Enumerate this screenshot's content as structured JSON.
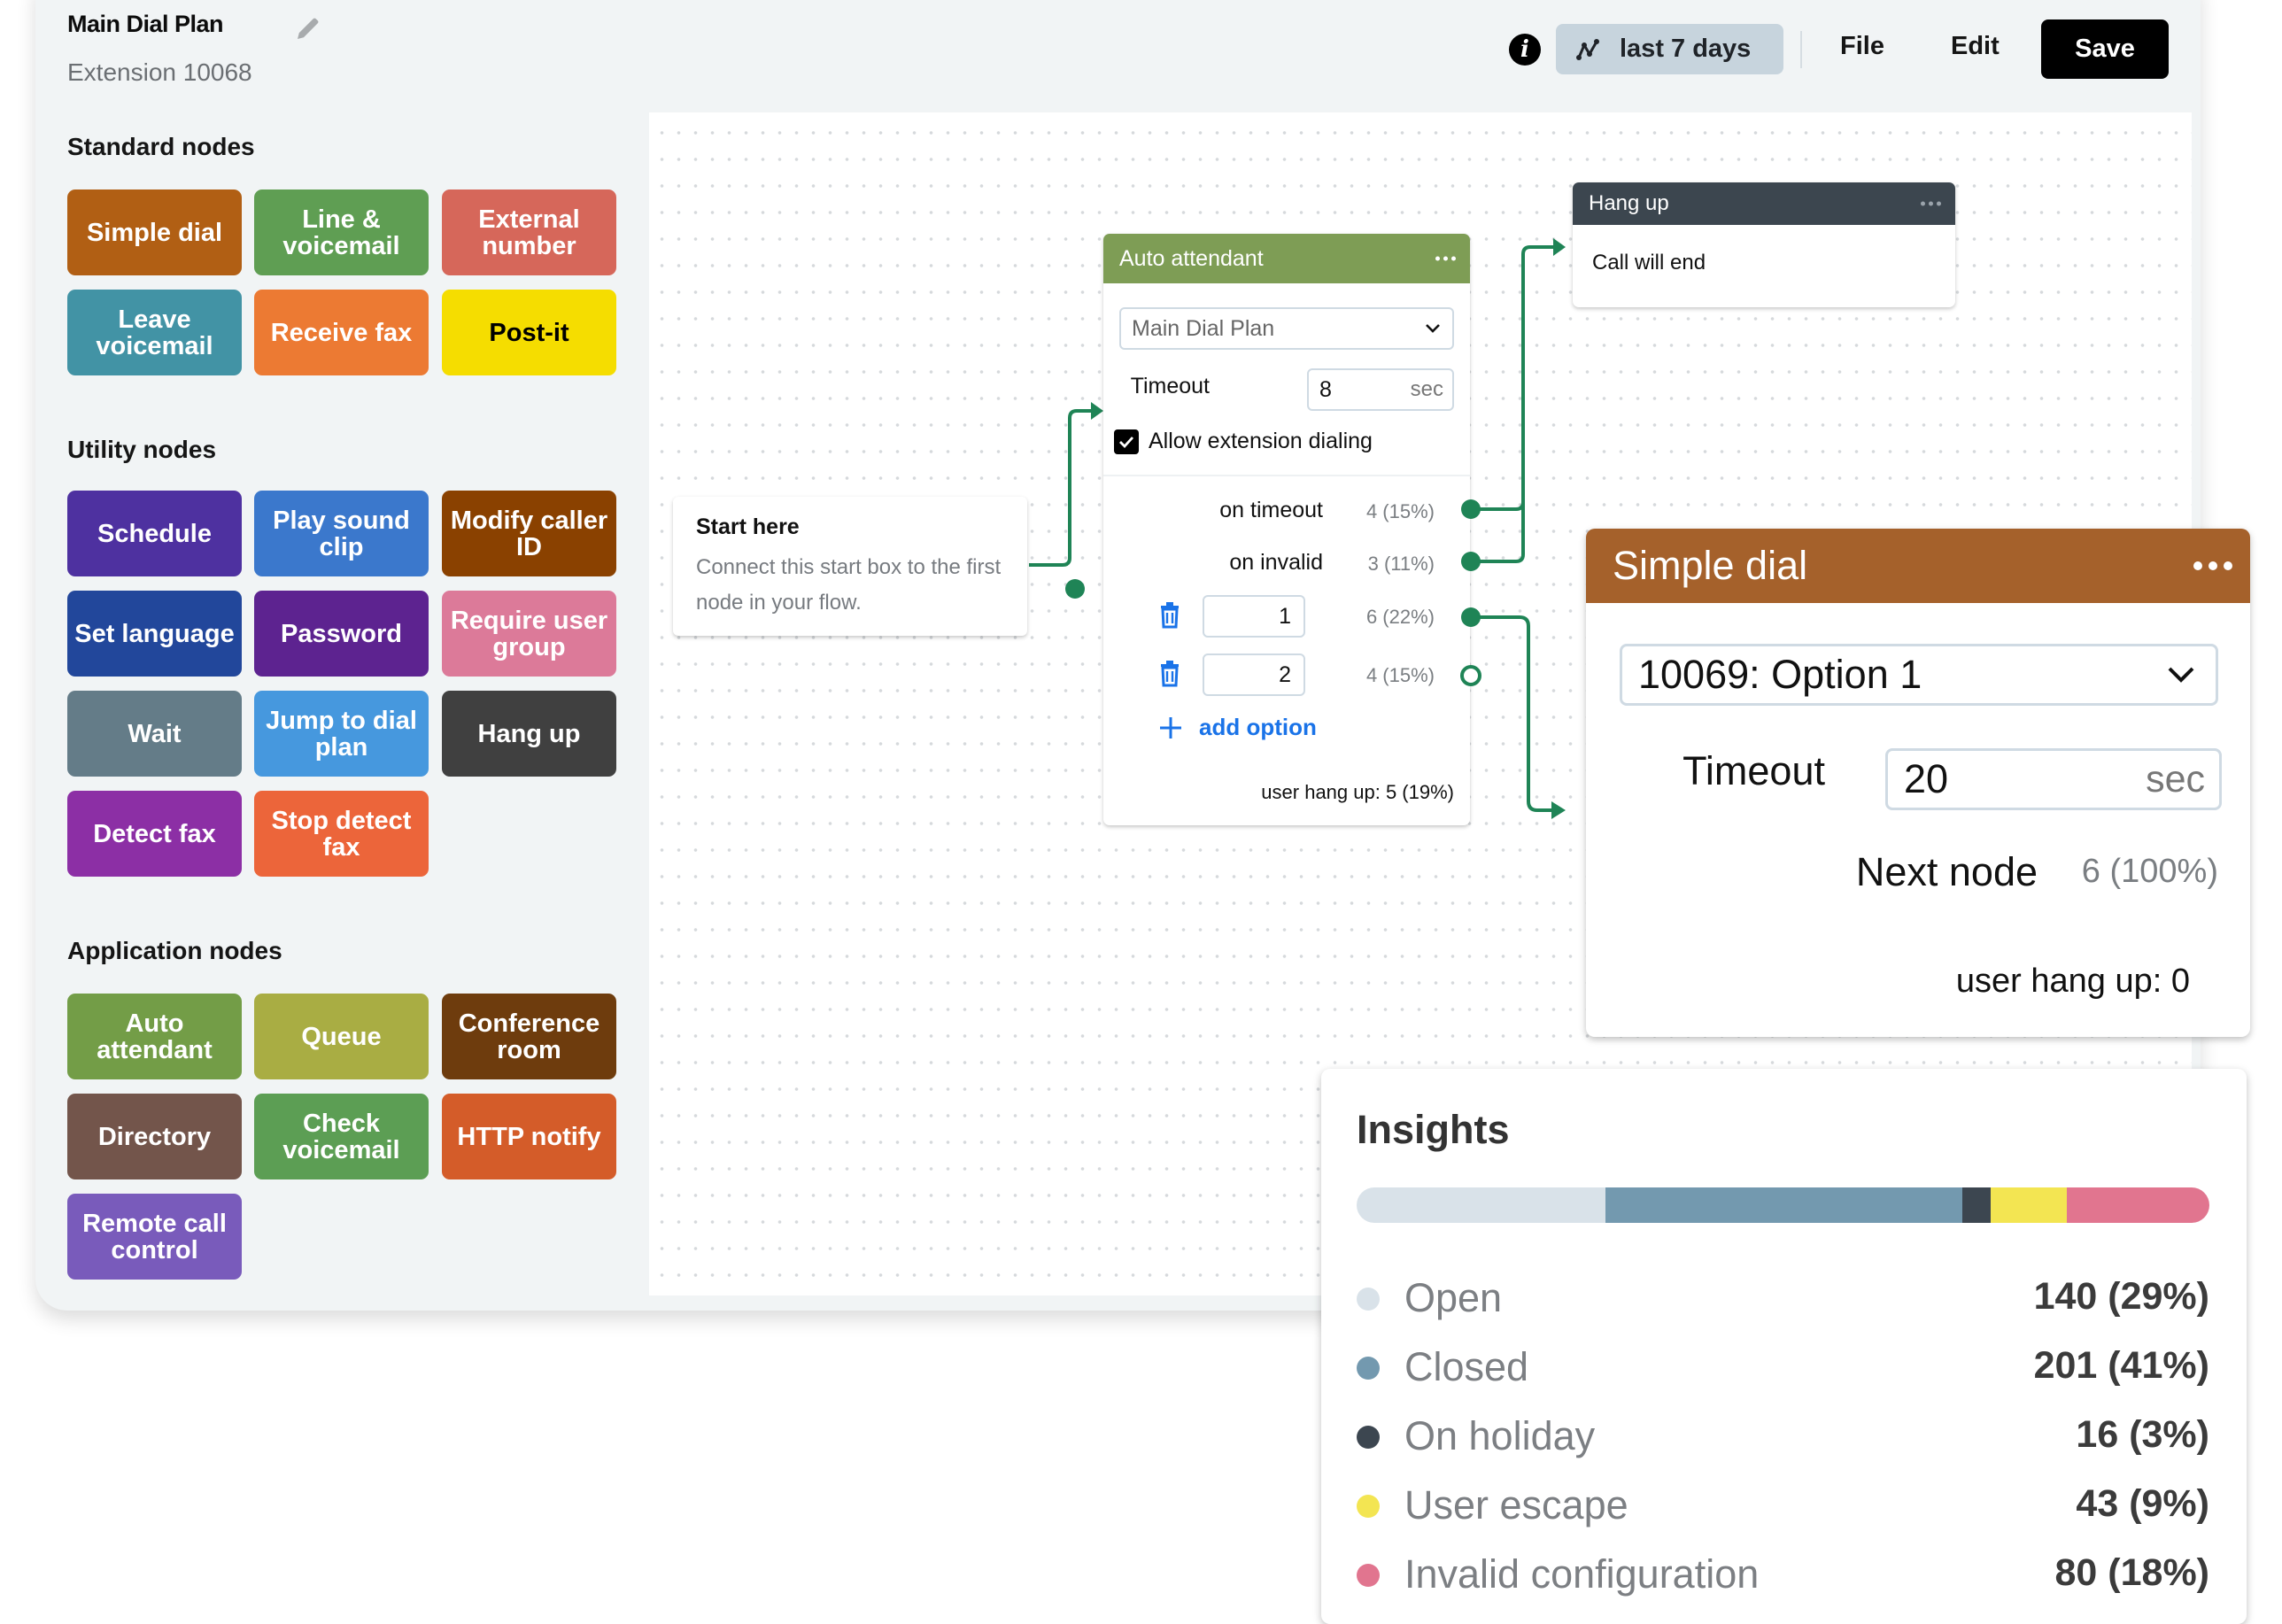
{
  "header": {
    "title": "Main Dial Plan",
    "subtitle": "Extension 10068",
    "edit_icon": "pencil-icon"
  },
  "topbar": {
    "info_icon": "info-icon",
    "range_icon": "trend-line-icon",
    "range_label": "last 7 days",
    "file_label": "File",
    "edit_label": "Edit",
    "save_label": "Save"
  },
  "sidebar": {
    "sections": [
      {
        "heading": "Standard nodes",
        "items": [
          {
            "label": "Simple dial",
            "color": "#b15f14"
          },
          {
            "label": "Line & voicemail",
            "color": "#5f9e53"
          },
          {
            "label": "External number",
            "color": "#d6675a"
          },
          {
            "label": "Leave voicemail",
            "color": "#4293a5"
          },
          {
            "label": "Receive fax",
            "color": "#ec7a33"
          },
          {
            "label": "Post-it",
            "color": "#f5dd00"
          }
        ]
      },
      {
        "heading": "Utility nodes",
        "items": [
          {
            "label": "Schedule",
            "color": "#4e31a0"
          },
          {
            "label": "Play sound clip",
            "color": "#3b78cc"
          },
          {
            "label": "Modify caller ID",
            "color": "#8a4100"
          },
          {
            "label": "Set language",
            "color": "#22479b"
          },
          {
            "label": "Password",
            "color": "#5d2390"
          },
          {
            "label": "Require user group",
            "color": "#dc7a99"
          },
          {
            "label": "Wait",
            "color": "#647c88"
          },
          {
            "label": "Jump to dial plan",
            "color": "#4698de"
          },
          {
            "label": "Hang up",
            "color": "#404040"
          },
          {
            "label": "Detect fax",
            "color": "#8c2fa5"
          },
          {
            "label": "Stop detect fax",
            "color": "#ec653a"
          }
        ]
      },
      {
        "heading": "Application nodes",
        "items": [
          {
            "label": "Auto attendant",
            "color": "#739d47"
          },
          {
            "label": "Queue",
            "color": "#a9ad43"
          },
          {
            "label": "Conference room",
            "color": "#6e3c0d"
          },
          {
            "label": "Directory",
            "color": "#73554b"
          },
          {
            "label": "Check voicemail",
            "color": "#5c9e54"
          },
          {
            "label": "HTTP notify",
            "color": "#d45c29"
          },
          {
            "label": "Remote call control",
            "color": "#795bbb"
          }
        ]
      }
    ]
  },
  "canvas": {
    "start": {
      "title": "Start here",
      "description": "Connect this start box to the first node in your flow."
    },
    "auto_attendant": {
      "title": "Auto attendant",
      "menu_icon": "more-dots-icon",
      "dial_plan_select": "Main Dial Plan",
      "timeout_label": "Timeout",
      "timeout_value": "8",
      "timeout_unit": "sec",
      "allow_extension_label": "Allow extension dialing",
      "allow_extension_checked": true,
      "outputs": [
        {
          "label": "on timeout",
          "count": "4 (15%)",
          "connected": true
        },
        {
          "label": "on invalid",
          "count": "3 (11%)",
          "connected": true
        },
        {
          "option": "1",
          "count": "6 (22%)",
          "connected": true
        },
        {
          "option": "2",
          "count": "4 (15%)",
          "connected": false
        }
      ],
      "add_option_label": "add option",
      "user_hang_up": "user hang up: 5 (19%)"
    },
    "hang_up": {
      "title": "Hang up",
      "body": "Call will end"
    },
    "simple_dial": {
      "title": "Simple dial",
      "target_select": "10069: Option 1",
      "timeout_label": "Timeout",
      "timeout_value": "20",
      "timeout_unit": "sec",
      "next_node_label": "Next node",
      "next_node_count": "6 (100%)",
      "user_hang_up": "user hang up: 0"
    }
  },
  "insights": {
    "title": "Insights",
    "items": [
      {
        "label": "Open",
        "value": "140 (29%)",
        "count": 140,
        "color": "#d9e2e9"
      },
      {
        "label": "Closed",
        "value": "201 (41%)",
        "count": 201,
        "color": "#7399af"
      },
      {
        "label": "On holiday",
        "value": "16 (3%)",
        "count": 16,
        "color": "#3c4650"
      },
      {
        "label": "User escape",
        "value": "43 (9%)",
        "count": 43,
        "color": "#f3e552"
      },
      {
        "label": "Invalid configuration",
        "value": "80 (18%)",
        "count": 80,
        "color": "#e1758f"
      }
    ]
  }
}
